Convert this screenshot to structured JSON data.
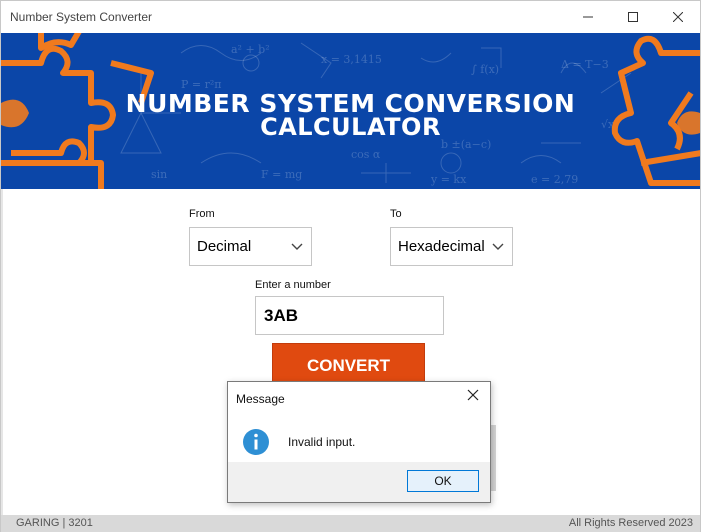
{
  "window": {
    "title": "Number System Converter"
  },
  "banner": {
    "line1": "NUMBER SYSTEM CONVERSION",
    "line2": "CALCULATOR"
  },
  "form": {
    "from_label": "From",
    "from_value": "Decimal",
    "to_label": "To",
    "to_value": "Hexadecimal",
    "number_label": "Enter a number",
    "number_value": "3AB",
    "convert_label": "CONVERT"
  },
  "dialog": {
    "title": "Message",
    "message": "Invalid input.",
    "ok_label": "OK",
    "icon": "info-icon"
  },
  "footer": {
    "left": "GARING | 3201",
    "right": "All Rights Reserved 2023"
  },
  "colors": {
    "banner_bg": "#0b46a8",
    "puzzle_orange": "#f07a1e",
    "convert_bg": "#e04a10",
    "info_blue": "#2e8fd4"
  }
}
